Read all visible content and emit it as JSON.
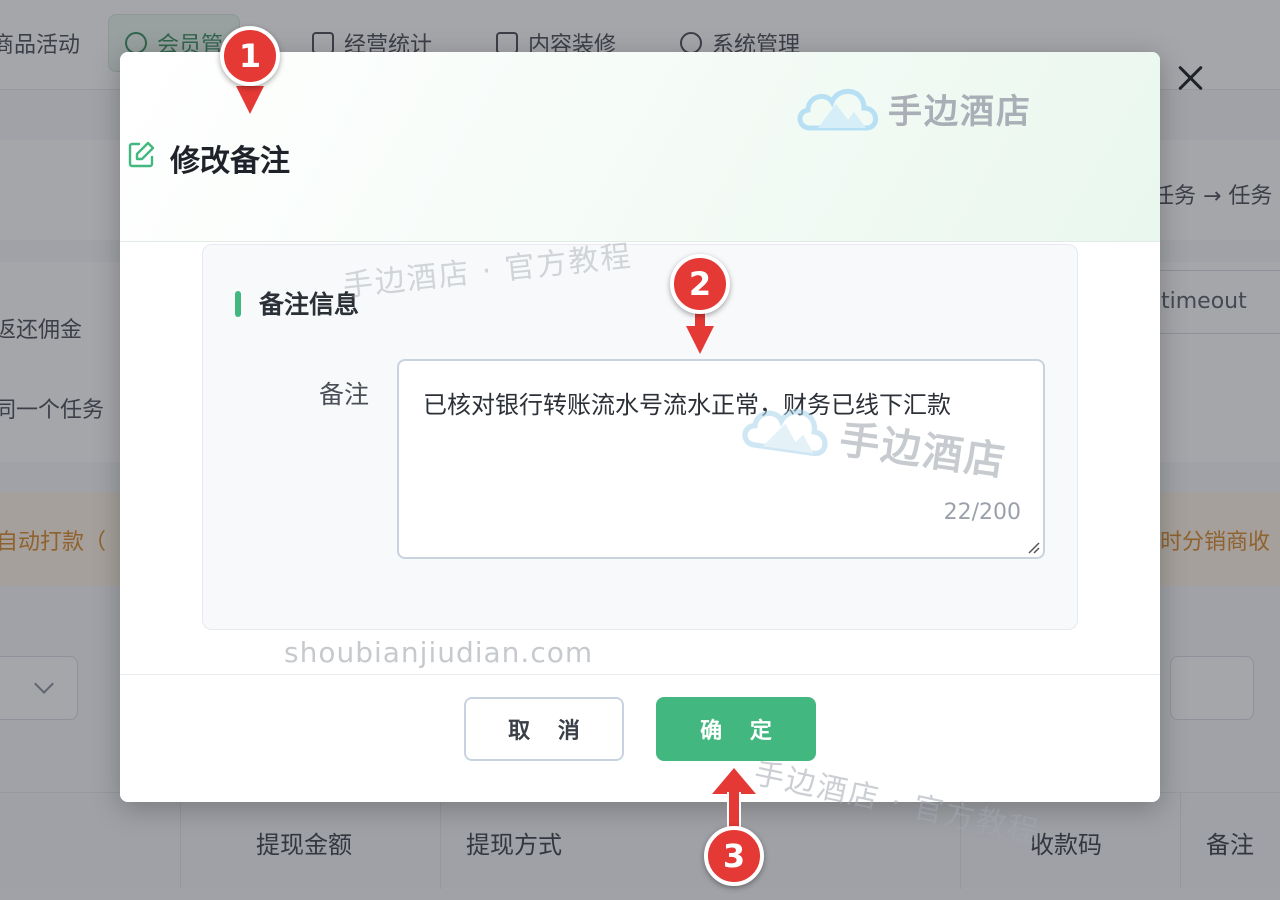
{
  "background": {
    "nav_tabs": [
      {
        "label": "商品活动",
        "icon": "none"
      },
      {
        "label": "会员管",
        "icon": "user-icon"
      },
      {
        "label": "经营统计",
        "icon": "chart-icon"
      },
      {
        "label": "内容装修",
        "icon": "layout-icon"
      },
      {
        "label": "系统管理",
        "icon": "gear-icon"
      }
    ],
    "breadcrumb_fragment": "任务 → 任务",
    "timeout_value": "timeout",
    "left_fragments": [
      "返还佣金",
      "同一个任务"
    ],
    "warning_left": "自动打款（",
    "warning_right": "时分销商收",
    "table_headers": [
      "提现金额",
      "提现方式",
      "收款码",
      "备注"
    ]
  },
  "dialog": {
    "title": "修改备注",
    "logo_text": "手边酒店",
    "section_title": "备注信息",
    "field_label": "备注",
    "remark_value": "已核对银行转账流水号流水正常，财务已线下汇款",
    "counter": "22/200",
    "cancel_label": "取 消",
    "confirm_label": "确 定"
  },
  "watermarks": {
    "tutorial": "手边酒店 · 官方教程",
    "url": "shoubianjiudian.com",
    "tutorial_bottom": "手边酒店 · 官方教程",
    "logo_text": "手边酒店"
  },
  "markers": [
    "1",
    "2",
    "3"
  ],
  "colors": {
    "accent": "#42b880",
    "marker": "#e53935",
    "warning_bg": "#fff4e5",
    "warning_text": "#d98b2b"
  }
}
